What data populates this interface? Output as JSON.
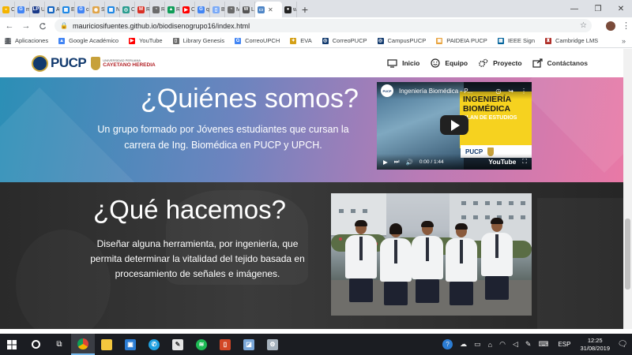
{
  "browser": {
    "tabs": [
      {
        "label": "Cr",
        "color": "#f4b400",
        "glyph": "◒"
      },
      {
        "label": "me",
        "color": "#4285f4",
        "glyph": "G"
      },
      {
        "label": "Un",
        "color": "#1a3a8a",
        "glyph": "LP"
      },
      {
        "label": "An",
        "color": "#1565c0",
        "glyph": "▦"
      },
      {
        "label": "Es",
        "color": "#1e88e5",
        "glyph": "▦"
      },
      {
        "label": "co",
        "color": "#4285f4",
        "glyph": "G"
      },
      {
        "label": "Sk",
        "color": "#e0a54a",
        "glyph": "◉"
      },
      {
        "label": "Ne",
        "color": "#1e88e5",
        "glyph": "▦"
      },
      {
        "label": "Co",
        "color": "#2a9d8f",
        "glyph": "◎"
      },
      {
        "label": "Re",
        "color": "#d93025",
        "glyph": "M"
      },
      {
        "label": "Re",
        "color": "#6b6b6b",
        "glyph": "◔"
      },
      {
        "label": "RE",
        "color": "#0f9d58",
        "glyph": "▲"
      },
      {
        "label": "Có",
        "color": "#ff0000",
        "glyph": "▶"
      },
      {
        "label": "qu",
        "color": "#4285f4",
        "glyph": "G"
      },
      {
        "label": "B_",
        "color": "#7baaf7",
        "glyph": "▯"
      },
      {
        "label": "Mi",
        "color": "#6b6b6b",
        "glyph": "◔"
      },
      {
        "label": "Le",
        "color": "#555555",
        "glyph": "W"
      },
      {
        "label": "",
        "color": "#4f86c6",
        "glyph": "▭",
        "active": true
      },
      {
        "label": "we",
        "color": "#222222",
        "glyph": "●"
      }
    ],
    "new_tab": "+",
    "window_controls": {
      "minimize": "—",
      "maximize": "❐",
      "close": "✕"
    },
    "nav": {
      "back": "←",
      "forward": "→",
      "reload": "C"
    },
    "url": "mauriciosifuentes.github.io/biodisenogrupo16/index.html",
    "bookmarks": [
      {
        "label": "Aplicaciones",
        "color": "#5f6368",
        "glyph": "⋮⋮"
      },
      {
        "label": "Google Académico",
        "color": "#4285f4",
        "glyph": "▲"
      },
      {
        "label": "YouTube",
        "color": "#ff0000",
        "glyph": "▶"
      },
      {
        "label": "Library Genesis",
        "color": "#6b6b6b",
        "glyph": "▯"
      },
      {
        "label": "CorreoUPCH",
        "color": "#4285f4",
        "glyph": "G"
      },
      {
        "label": "EVA",
        "color": "#d4a017",
        "glyph": "✦"
      },
      {
        "label": "CorreoPUCP",
        "color": "#123a6e",
        "glyph": "◎"
      },
      {
        "label": "CampusPUCP",
        "color": "#123a6e",
        "glyph": "◎"
      },
      {
        "label": "PAIDEIA PUCP",
        "color": "#e8a33d",
        "glyph": "▣"
      },
      {
        "label": "IEEE Sign",
        "color": "#00629b",
        "glyph": "▦"
      },
      {
        "label": "Cambridge LMS",
        "color": "#b0302a",
        "glyph": "♜"
      }
    ],
    "bookmarks_more": "»"
  },
  "site": {
    "logo_text": "PUCP",
    "logo_upch_small": "UNIVERSIDAD PERUANA",
    "logo_upch_name": "CAYETANO HEREDIA",
    "nav": [
      {
        "label": "Inicio",
        "icon": "monitor-icon"
      },
      {
        "label": "Equipo",
        "icon": "smile-icon"
      },
      {
        "label": "Proyecto",
        "icon": "gears-icon"
      },
      {
        "label": "Contáctanos",
        "icon": "share-icon"
      }
    ],
    "who": {
      "title": "¿Quiénes somos?",
      "text": "Un grupo formado por Jóvenes estudiantes que cursan la carrera de Ing. Biomédica en PUCP y UPCH."
    },
    "video": {
      "title": "Ingeniería Biomédica - P...",
      "panel_line1": "INGENIERÍA",
      "panel_line2": "BIOMÉDICA",
      "panel_line3": "PLAN DE ESTUDIOS",
      "logos_text": "PUCP",
      "time": "0:00 / 1:44",
      "brand": "YouTube"
    },
    "what": {
      "title": "¿Qué hacemos?",
      "text": "Diseñar alguna herramienta, por ingeniería, que permita determinar la vitalidad del tejido basada en procesamiento de señales e imágenes."
    }
  },
  "taskbar": {
    "tray_lang": "ESP",
    "time": "12:25",
    "date": "31/08/2019"
  }
}
